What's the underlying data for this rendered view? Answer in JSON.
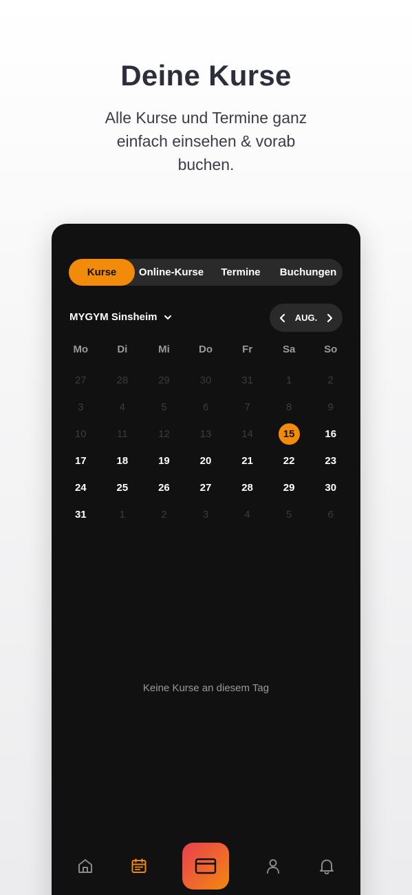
{
  "promo": {
    "title": "Deine Kurse",
    "subtitle": "Alle Kurse und Termine ganz einfach einsehen & vorab buchen."
  },
  "tabs": [
    {
      "label": "Kurse",
      "active": true
    },
    {
      "label": "Online-Kurse",
      "active": false
    },
    {
      "label": "Termine",
      "active": false
    },
    {
      "label": "Buchungen",
      "active": false
    }
  ],
  "studio": {
    "name": "MYGYM Sinsheim"
  },
  "month": {
    "label": "AUG."
  },
  "weekdays": [
    "Mo",
    "Di",
    "Mi",
    "Do",
    "Fr",
    "Sa",
    "So"
  ],
  "calendar": {
    "selected_day": "15",
    "rows": [
      [
        "27",
        "28",
        "29",
        "30",
        "31",
        "1",
        "2"
      ],
      [
        "3",
        "4",
        "5",
        "6",
        "7",
        "8",
        "9"
      ],
      [
        "10",
        "11",
        "12",
        "13",
        "14",
        "15",
        "16"
      ],
      [
        "17",
        "18",
        "19",
        "20",
        "21",
        "22",
        "23"
      ],
      [
        "24",
        "25",
        "26",
        "27",
        "28",
        "29",
        "30"
      ],
      [
        "31",
        "1",
        "2",
        "3",
        "4",
        "5",
        "6"
      ]
    ]
  },
  "empty_message": "Keine Kurse an diesem Tag",
  "colors": {
    "accent": "#f28a0a",
    "background": "#111111"
  },
  "bottom_nav": [
    "home-icon",
    "calendar-icon",
    "card-icon",
    "user-icon",
    "bell-icon"
  ]
}
